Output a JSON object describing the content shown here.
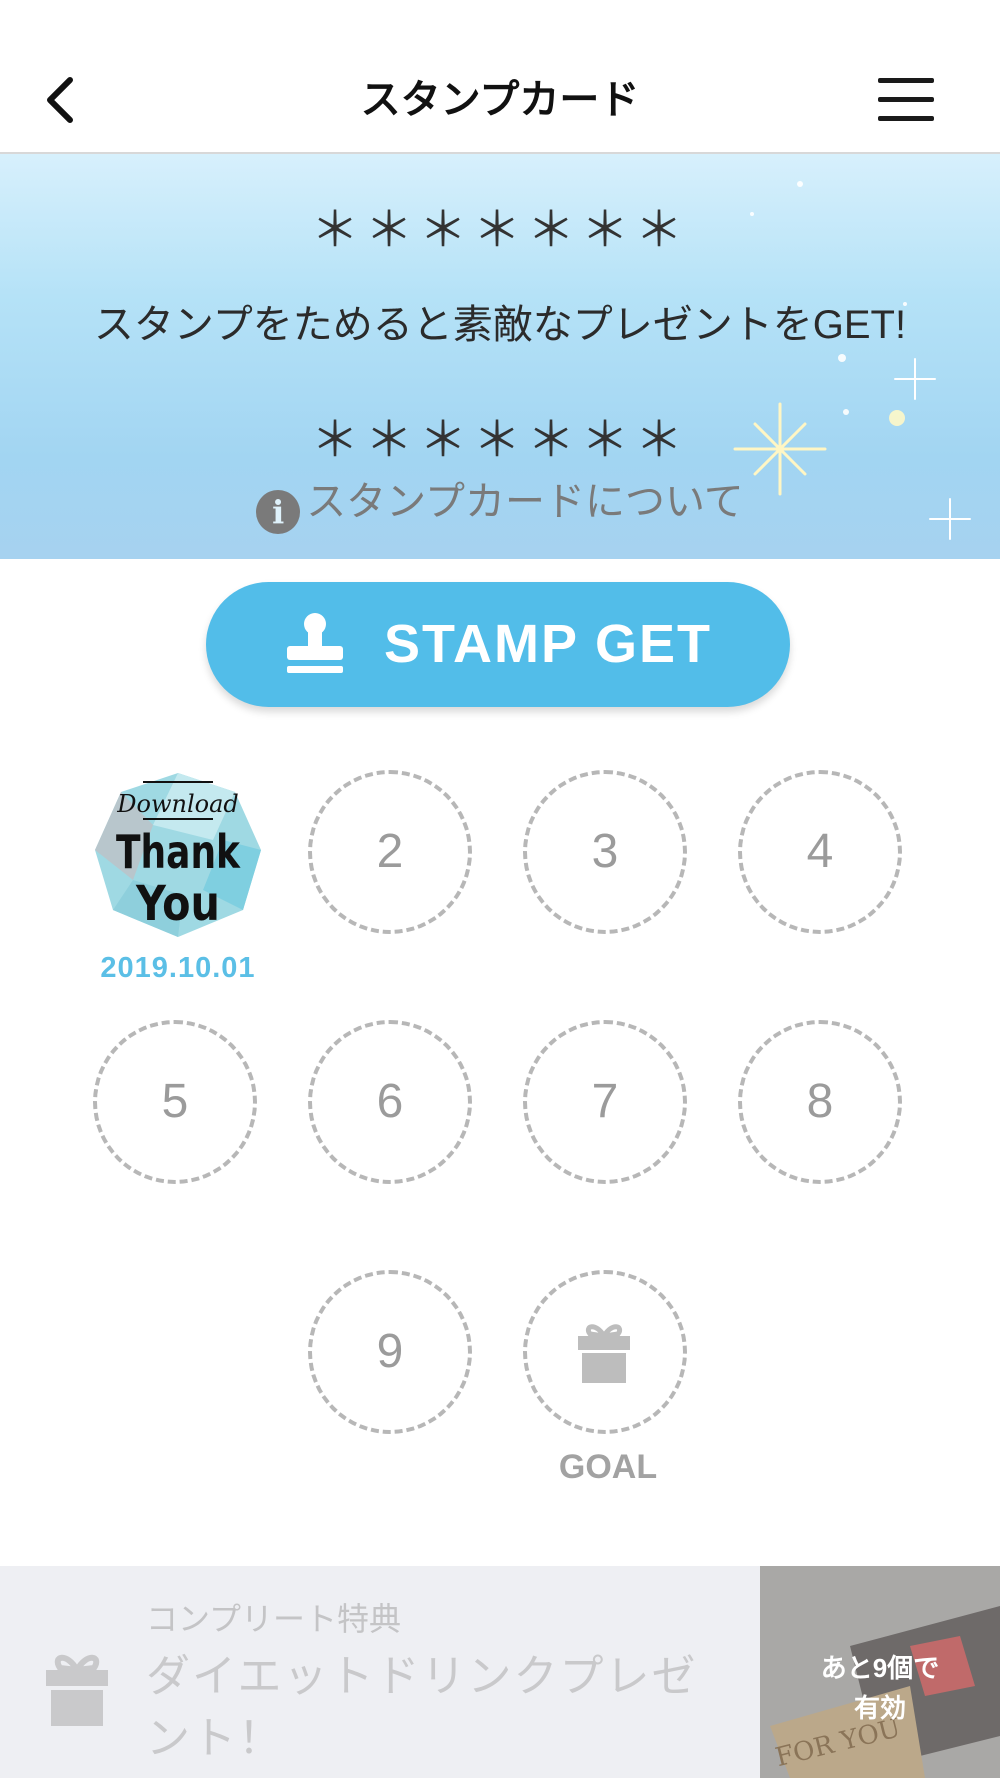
{
  "header": {
    "title": "スタンプカード",
    "back_icon": "chevron-left-icon",
    "menu_icon": "hamburger-menu-icon"
  },
  "banner": {
    "stars_top": "＊＊＊＊＊＊＊",
    "message": "スタンプをためると素敵なプレゼントをGET!",
    "stars_bottom": "＊＊＊＊＊＊＊",
    "about_label": "スタンプカードについて",
    "about_icon": "info-icon",
    "info_glyph": "i"
  },
  "stamp_button": {
    "label": "STAMP GET",
    "icon": "stamp-icon",
    "color": "#52bde9"
  },
  "stamp_card": {
    "collected": {
      "badge_lines": [
        "Download",
        "Thank",
        "You"
      ],
      "date": "2019.10.01"
    },
    "slots": [
      "2",
      "3",
      "4",
      "5",
      "6",
      "7",
      "8",
      "9"
    ],
    "goal_label": "GOAL",
    "goal_icon": "gift-icon"
  },
  "complete_reward": {
    "heading": "コンプリート特典",
    "name": "ダイエットドリンクプレゼント！",
    "remaining": "あと9個で",
    "valid": "有効",
    "image_text": "FOR YOU",
    "icon": "gift-icon"
  },
  "colors": {
    "accent": "#52bde9",
    "date": "#5bbfe6",
    "slot_border": "#b7b7b7"
  }
}
